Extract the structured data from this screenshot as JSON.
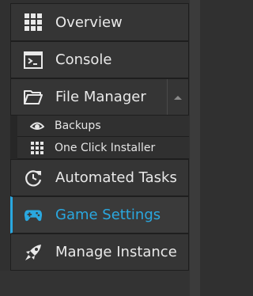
{
  "nav": {
    "items": [
      {
        "id": "overview",
        "label": "Overview",
        "icon": "grid-icon"
      },
      {
        "id": "console",
        "label": "Console",
        "icon": "terminal-icon"
      },
      {
        "id": "file-manager",
        "label": "File Manager",
        "icon": "folder-icon",
        "expanded": true
      },
      {
        "id": "automated-tasks",
        "label": "Automated Tasks",
        "icon": "clock-refresh-icon"
      },
      {
        "id": "game-settings",
        "label": "Game Settings",
        "icon": "gamepad-icon",
        "active": true
      },
      {
        "id": "manage-instance",
        "label": "Manage Instance",
        "icon": "rocket-icon"
      }
    ],
    "file_manager_sub": [
      {
        "label": "Backups",
        "icon": "eye-icon"
      },
      {
        "label": "One Click Installer",
        "icon": "grid-icon"
      }
    ]
  },
  "colors": {
    "accent": "#2aa8e0",
    "text": "#e9e9e9",
    "item_bg": "#353535",
    "page_bg": "#303030"
  }
}
